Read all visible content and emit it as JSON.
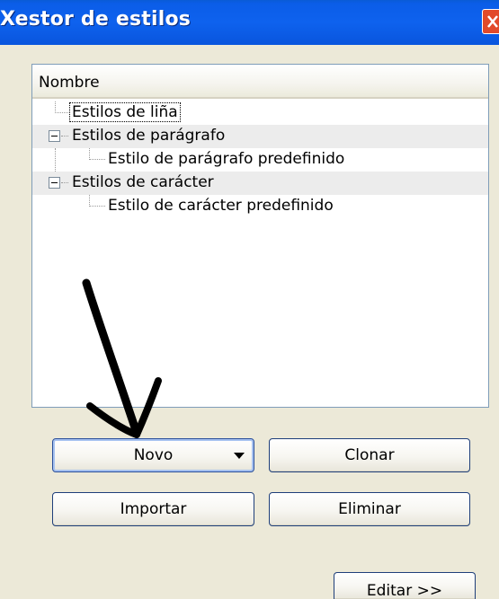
{
  "window": {
    "title": "Xestor de estilos",
    "close_icon": "close-icon"
  },
  "tree": {
    "column_header": "Nombre",
    "items": [
      {
        "label": "Estilos de liña"
      },
      {
        "label": "Estilos de parágrafo"
      },
      {
        "label": "Estilo de parágrafo predefinido"
      },
      {
        "label": "Estilos de carácter"
      },
      {
        "label": "Estilo de carácter predefinido"
      }
    ]
  },
  "buttons": {
    "new_label": "Novo",
    "clone_label": "Clonar",
    "import_label": "Importar",
    "delete_label": "Eliminar",
    "edit_label": "Editar >>"
  },
  "annotation": {
    "icon": "hand-drawn-arrow-icon",
    "color": "#000000"
  },
  "colors": {
    "title_bar": "#0e62ee",
    "window_background": "#ece9d8",
    "close_button": "#e24a2a",
    "button_border": "#1f3f7a"
  }
}
